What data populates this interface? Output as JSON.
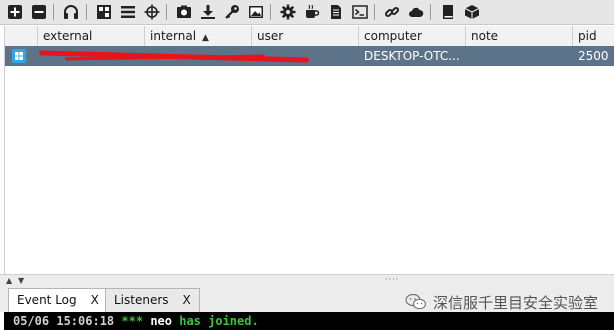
{
  "toolbar": {
    "icons": [
      "add-icon",
      "remove-icon",
      "headphones-icon",
      "pivot-graph-icon",
      "session-table-icon",
      "crosshair-icon",
      "screenshot-icon",
      "download-icon",
      "key-icon",
      "image-icon",
      "settings-icon",
      "coffee-icon",
      "document-icon",
      "console-icon",
      "link-icon",
      "cloud-icon",
      "book-icon",
      "package-icon"
    ]
  },
  "table": {
    "columns": [
      "external",
      "internal",
      "user",
      "computer",
      "note",
      "pid"
    ],
    "sort_column": "internal",
    "sort_direction": "ascending",
    "rows": [
      {
        "os_icon": "windows-icon",
        "external": "",
        "internal": "",
        "user": "",
        "computer": "DESKTOP-OTC...",
        "note": "",
        "pid": "2500",
        "redacted": true
      }
    ]
  },
  "tabs": [
    {
      "label": "Event Log",
      "close": "X",
      "active": true
    },
    {
      "label": "Listeners",
      "close": "X",
      "active": false
    }
  ],
  "console": {
    "timestamp": "05/06 15:06:18",
    "stars": "***",
    "nick": "neo",
    "message": "has joined."
  },
  "watermark": {
    "text": "深信服千里目安全实验室"
  },
  "colors": {
    "selected_row": "#5d7389",
    "redaction": "#e8141c",
    "console_bg": "#000000",
    "console_green": "#3ac43a"
  }
}
